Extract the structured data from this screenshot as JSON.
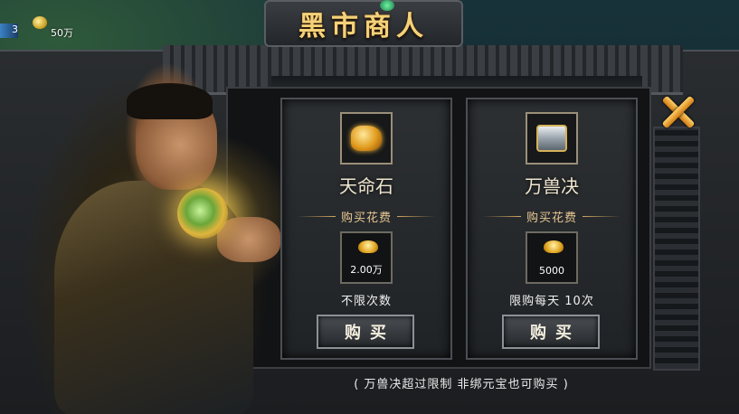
{
  "hud": {
    "level_fragment": "3",
    "gold_amount": "50万"
  },
  "window": {
    "title": "黑市商人",
    "close_icon": "close-x-icon",
    "footer_note": "( 万兽决超过限制 非绑元宝也可购买 )"
  },
  "items": [
    {
      "name": "天命石",
      "icon": "orange-gem-icon",
      "cost_label": "购买花费",
      "currency_icon": "gold-ingot-icon",
      "price": "2.00万",
      "limit": "不限次数",
      "buy_label": "购买"
    },
    {
      "name": "万兽决",
      "icon": "silver-chest-icon",
      "cost_label": "购买花费",
      "currency_icon": "gold-ingot-icon",
      "price": "5000",
      "limit": "限购每天 10次",
      "buy_label": "购买"
    }
  ],
  "colors": {
    "title_gold": "#f3d27a",
    "accent_orange": "#e09a1c",
    "frame_gray": "#4b4f54"
  }
}
